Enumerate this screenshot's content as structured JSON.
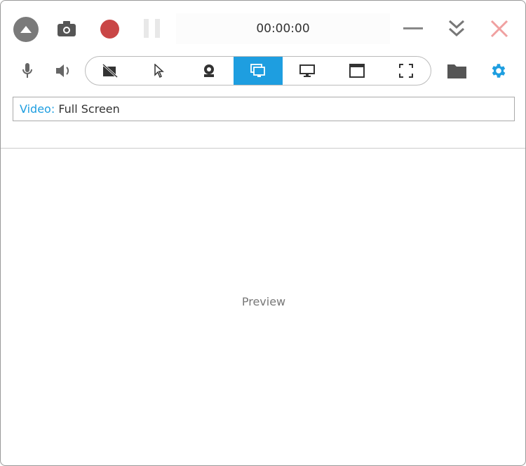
{
  "toolbar": {
    "timer": "00:00:00"
  },
  "sources": [
    "no-camera",
    "cursor",
    "webcam",
    "screen-region",
    "monitor",
    "window",
    "full-screen"
  ],
  "video": {
    "label": "Video:",
    "value": "Full Screen"
  },
  "preview": {
    "label": "Preview"
  },
  "colors": {
    "accent": "#1e9ee0",
    "record": "#c94646",
    "close": "#f0a0a0"
  }
}
